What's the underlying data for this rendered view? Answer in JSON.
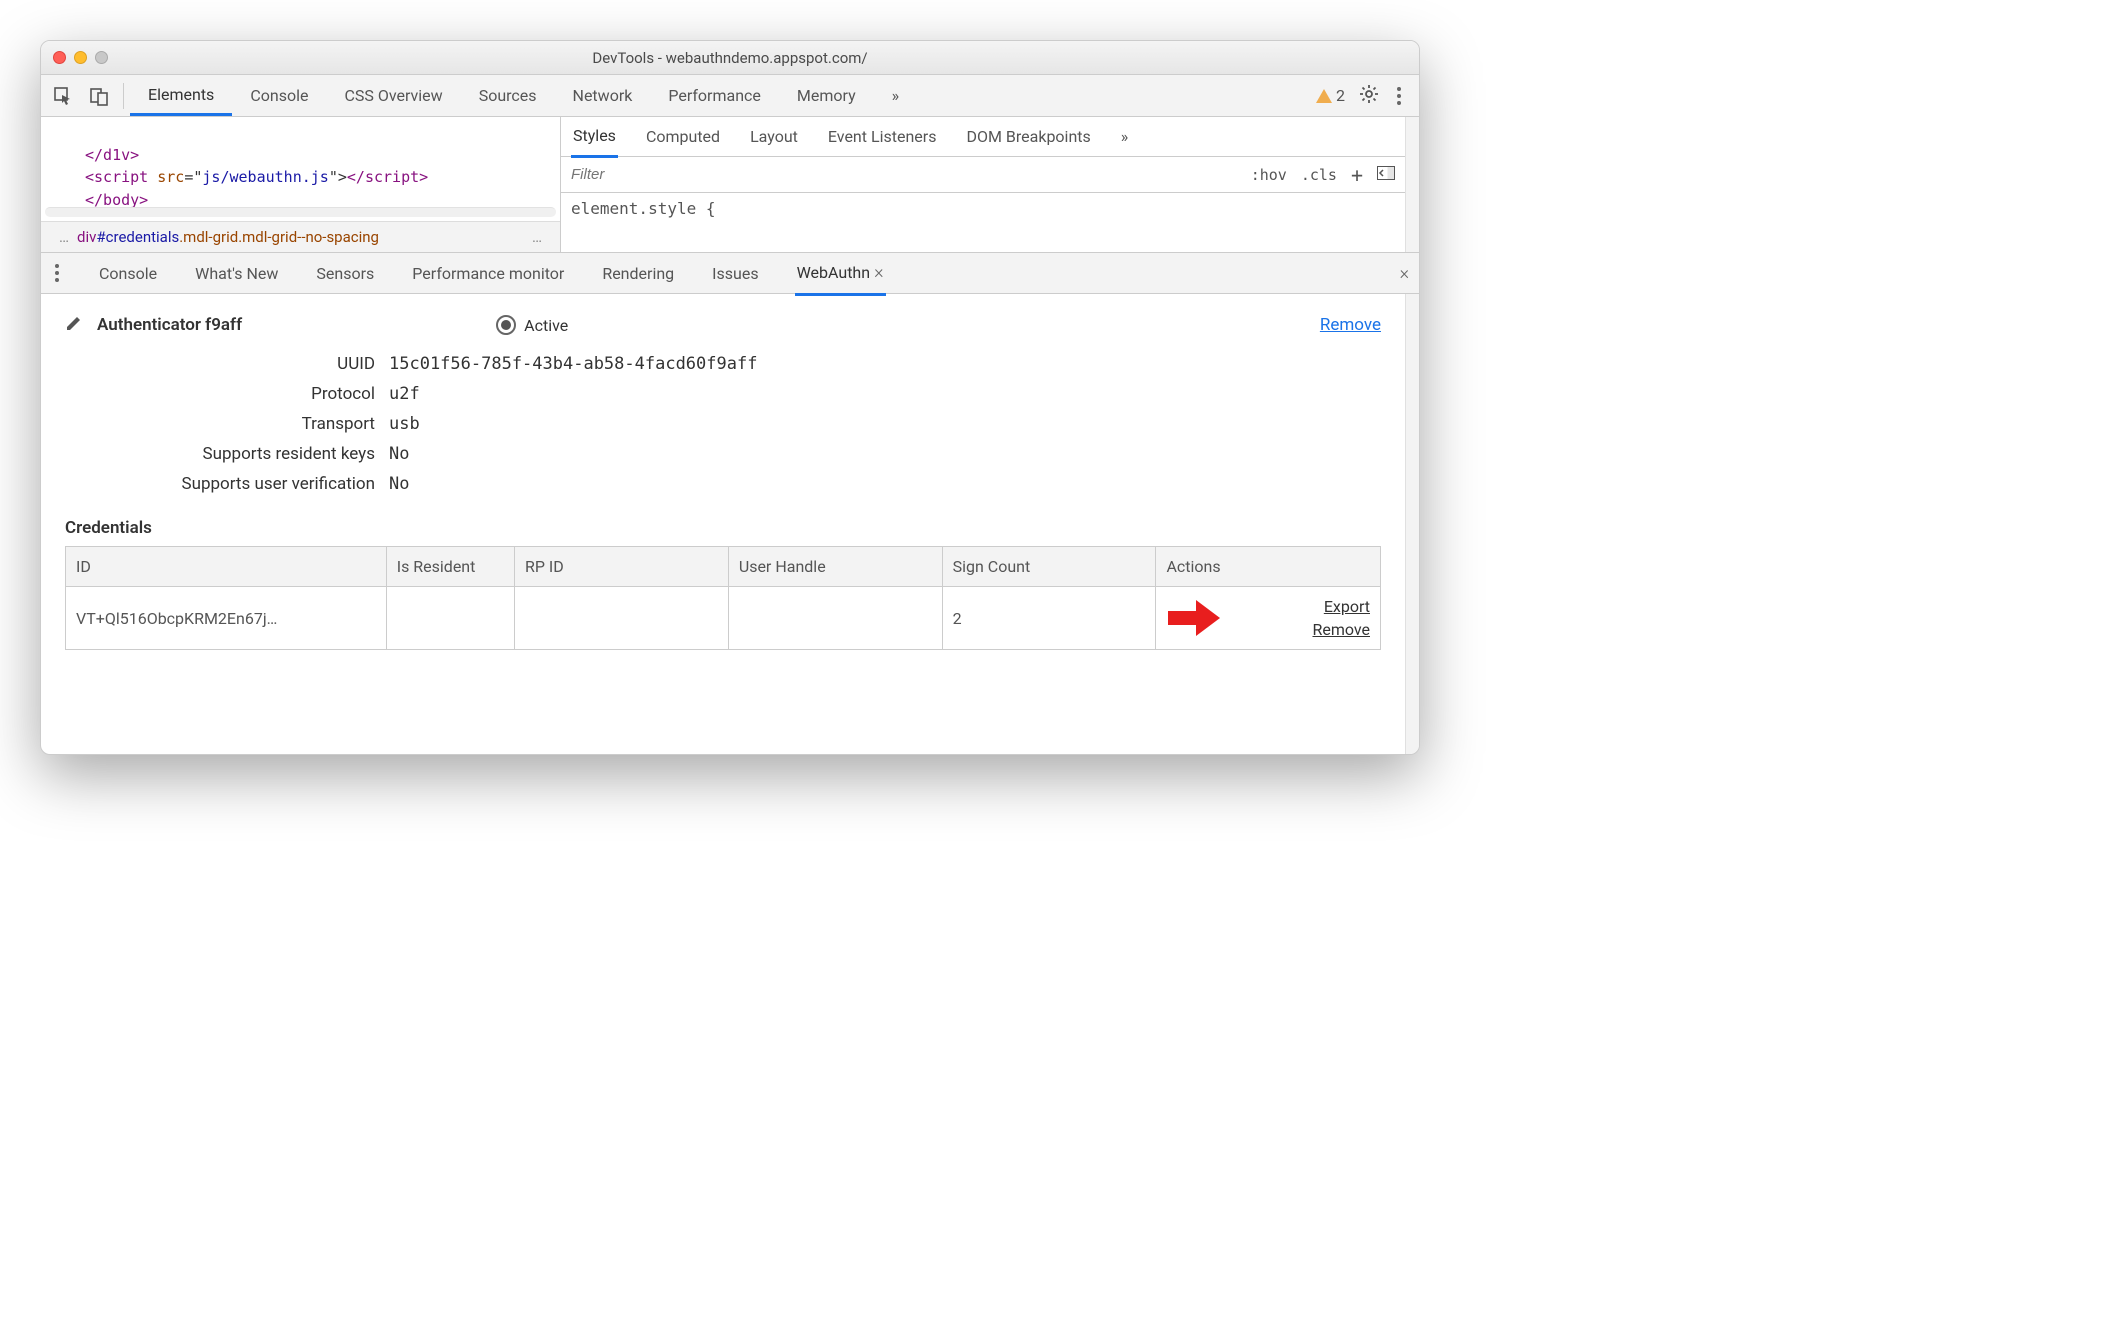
{
  "window": {
    "title": "DevTools - webauthndemo.appspot.com/"
  },
  "main_tabs": {
    "items": [
      "Elements",
      "Console",
      "CSS Overview",
      "Sources",
      "Network",
      "Performance",
      "Memory"
    ],
    "overflow": "»",
    "warning_count": "2"
  },
  "code": {
    "l1": "</d1v>",
    "l2a": "<script ",
    "l2b": "src",
    "l2c": "=\"",
    "l2d": "js/webauthn.js",
    "l2e": "\">",
    "l2f": "</script>",
    "l3": "</body>"
  },
  "breadcrumb": {
    "pre": "…",
    "tag": "div",
    "id": "#credentials",
    "cls": ".mdl-grid.mdl-grid--no-spacing",
    "post": "…"
  },
  "styles_tabs": {
    "items": [
      "Styles",
      "Computed",
      "Layout",
      "Event Listeners",
      "DOM Breakpoints"
    ],
    "overflow": "»"
  },
  "filter": {
    "placeholder": "Filter",
    "hov": ":hov",
    "cls": ".cls",
    "plus": "+"
  },
  "element_style": "element.style {",
  "drawer": {
    "tabs": [
      "Console",
      "What's New",
      "Sensors",
      "Performance monitor",
      "Rendering",
      "Issues",
      "WebAuthn"
    ],
    "active": "WebAuthn"
  },
  "authenticator": {
    "name": "Authenticator f9aff",
    "active_label": "Active",
    "remove_label": "Remove",
    "props": {
      "uuid_label": "UUID",
      "uuid": "15c01f56-785f-43b4-ab58-4facd60f9aff",
      "protocol_label": "Protocol",
      "protocol": "u2f",
      "transport_label": "Transport",
      "transport": "usb",
      "resident_label": "Supports resident keys",
      "resident": "No",
      "userver_label": "Supports user verification",
      "userver": "No"
    }
  },
  "credentials": {
    "heading": "Credentials",
    "columns": [
      "ID",
      "Is Resident",
      "RP ID",
      "User Handle",
      "Sign Count",
      "Actions"
    ],
    "rows": [
      {
        "id": "VT+Ql516ObcpKRM2En67j…",
        "is_resident": "",
        "rp_id": "",
        "user_handle": "",
        "sign_count": "2",
        "export_label": "Export",
        "remove_label": "Remove"
      }
    ]
  }
}
